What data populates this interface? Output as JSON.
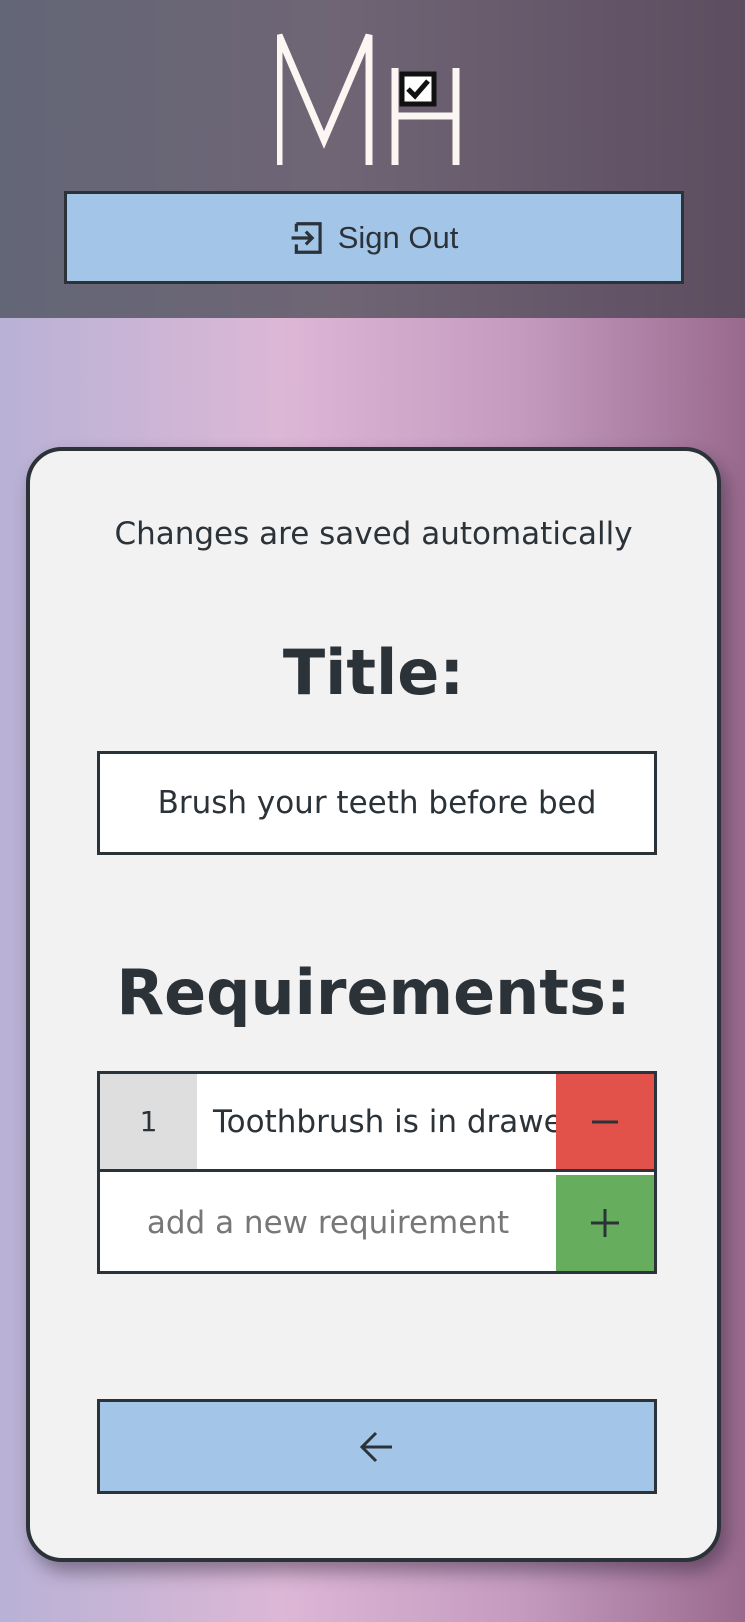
{
  "header": {
    "logo_text": "MH",
    "signout_label": "Sign Out"
  },
  "editor": {
    "note": "Changes are saved automatically",
    "title_heading": "Title:",
    "title_value": "Brush your teeth before bed",
    "requirements_heading": "Requirements:",
    "requirements": [
      {
        "number": "1",
        "text": "Toothbrush is in drawer"
      }
    ],
    "new_requirement_placeholder": "add a new requirement"
  },
  "icons": {
    "signout": "sign-in-arrow-icon",
    "remove": "minus-icon",
    "add": "plus-icon",
    "back": "arrow-left-icon",
    "logo_check": "checkbox-checked-icon"
  },
  "colors": {
    "button_blue": "#a2c5e8",
    "remove_red": "#e2524a",
    "add_green": "#66ad5d",
    "text_dark": "#2b3238"
  }
}
